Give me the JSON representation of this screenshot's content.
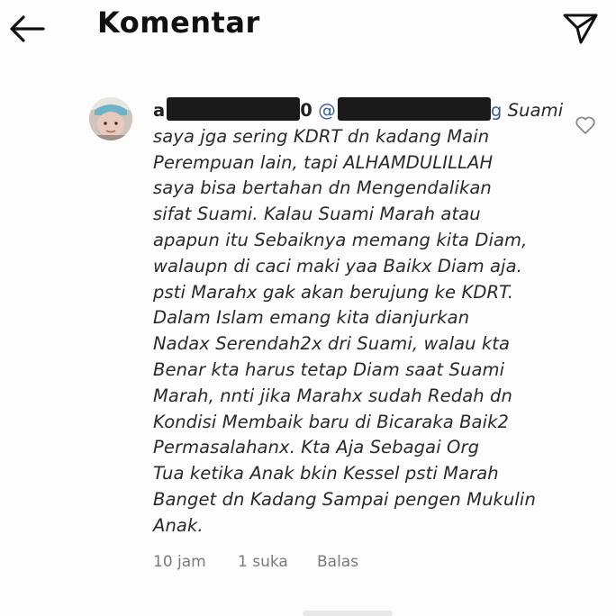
{
  "header": {
    "title": "Komentar",
    "back_icon": "arrow-left-icon",
    "share_icon": "paper-plane-icon"
  },
  "comment": {
    "username_start": "a",
    "username_end": "0",
    "mention_prefix": "@",
    "mention_end": "g",
    "line1_tail": " Suami",
    "lines": [
      "saya jga sering KDRT dn kadang Main",
      "Perempuan lain, tapi ALHAMDULILLAH",
      "saya bisa bertahan dn Mengendalikan",
      "sifat Suami. Kalau Suami Marah atau",
      "apapun itu Sebaiknya memang kita Diam,",
      "walaupn di caci maki yaa Baikx Diam aja.",
      "psti Marahx gak akan berujung ke KDRT.",
      "Dalam Islam emang kita dianjurkan",
      "Nadax Serendah2x dri Suami, walau kta",
      "Benar kta harus tetap Diam saat Suami",
      "Marah, nnti jika Marahx sudah Redah dn",
      "Kondisi Membaik baru di Bicaraka Baik2",
      "Permasalahanx. Kta Aja Sebagai Org",
      "Tua ketika Anak bkin Kessel psti Marah",
      "Banget dn Kadang Sampai pengen Mukulin",
      "Anak."
    ],
    "time": "10 jam",
    "likes": "1 suka",
    "reply": "Balas",
    "heart_icon": "heart-outline-icon"
  }
}
